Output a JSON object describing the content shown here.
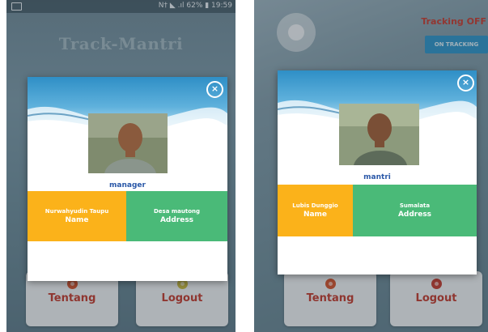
{
  "left_screen": {
    "status_text": "N† ◣ .ıl 62% ▮ 19:59",
    "app_title": "Track-Mantri",
    "modal": {
      "close_glyph": "×",
      "role": "manager",
      "name_value": "Nurwahyudin Taupu",
      "name_label": "Name",
      "address_value": "Desa mautong",
      "address_label": "Address"
    },
    "tentang_label": "Tentang",
    "logout_label": "Logout"
  },
  "right_screen": {
    "tracking_title": "Tracking OFF",
    "tracking_button": "ON TRACKING",
    "modal": {
      "close_glyph": "×",
      "role": "mantri",
      "name_value": "Lubis Dunggio",
      "name_label": "Name",
      "address_value": "Sumalata",
      "address_label": "Address"
    },
    "tentang_label": "Tentang",
    "logout_label": "Logout"
  },
  "colors": {
    "name_cell": "#fbb21a",
    "address_cell": "#4aba78",
    "role_text": "#2a58a8",
    "tentang_text": "#c0392b",
    "logout_text": "#c0392b",
    "tentang_dot": "#d0502a",
    "logout_dot": "#c5b53a",
    "tracking_off": "#c43a2e"
  },
  "icons": [
    "sim-card-icon",
    "close-icon",
    "tentang-dot-icon",
    "logout-dot-icon"
  ]
}
